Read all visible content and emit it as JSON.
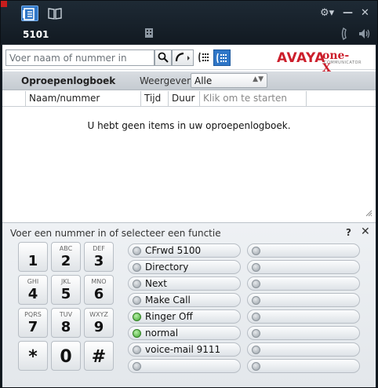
{
  "window": {
    "extension": "5101",
    "colors": {
      "brand_red": "#cc1f2c",
      "accent_blue": "#2f76c7",
      "led_green": "#3fa52f"
    }
  },
  "search": {
    "placeholder": "Voer naam of nummer in"
  },
  "brand": {
    "avaya": "AVAYA",
    "onex": "one-X",
    "sub": "COMMUNICATOR"
  },
  "call_log": {
    "title": "Oproepenlogboek",
    "view_label": "Weergeven",
    "view_value": "Alle",
    "columns": [
      "Naam/nummer",
      "Tijd",
      "Duur",
      "Klik om te starten"
    ],
    "empty_message": "U hebt geen items in uw oproepenlogboek."
  },
  "dialpad": {
    "hint": "Voer een nummer in of selecteer een functie",
    "help": "?",
    "close": "✕",
    "keys": [
      {
        "digit": "1",
        "letters": ""
      },
      {
        "digit": "2",
        "letters": "ABC"
      },
      {
        "digit": "3",
        "letters": "DEF"
      },
      {
        "digit": "4",
        "letters": "GHI"
      },
      {
        "digit": "5",
        "letters": "JKL"
      },
      {
        "digit": "6",
        "letters": "MNO"
      },
      {
        "digit": "7",
        "letters": "PQRS"
      },
      {
        "digit": "8",
        "letters": "TUV"
      },
      {
        "digit": "9",
        "letters": "WXYZ"
      },
      {
        "digit": "*",
        "letters": ""
      },
      {
        "digit": "0",
        "letters": ""
      },
      {
        "digit": "#",
        "letters": ""
      }
    ],
    "functions_left": [
      {
        "label": "CFrwd 5100",
        "active": false
      },
      {
        "label": "Directory",
        "active": false
      },
      {
        "label": "Next",
        "active": false
      },
      {
        "label": "Make Call",
        "active": false
      },
      {
        "label": "Ringer Off",
        "active": true
      },
      {
        "label": "normal",
        "active": true
      },
      {
        "label": "voice-mail 9111",
        "active": false
      },
      {
        "label": "",
        "active": false
      }
    ],
    "functions_right": [
      {
        "label": "",
        "active": false
      },
      {
        "label": "",
        "active": false
      },
      {
        "label": "",
        "active": false
      },
      {
        "label": "",
        "active": false
      },
      {
        "label": "",
        "active": false
      },
      {
        "label": "",
        "active": false
      },
      {
        "label": "",
        "active": false
      },
      {
        "label": "",
        "active": false
      }
    ]
  }
}
